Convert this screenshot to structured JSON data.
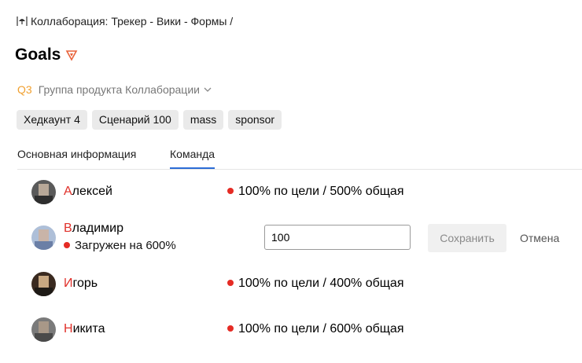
{
  "breadcrumb": {
    "icon": "umbrella-icon",
    "text": "Коллаборация: Трекер - Вики - Формы /"
  },
  "page": {
    "title": "Goals",
    "title_icon": "priority-triangle-icon",
    "title_icon_color": "#e8623a"
  },
  "meta": {
    "quarter": "Q3",
    "group": "Группа продукта Коллаборации",
    "quarter_color": "#f0a030"
  },
  "tags": [
    "Хедкаунт 4",
    "Сценарий 100",
    "mass",
    "sponsor"
  ],
  "tabs": [
    {
      "label": "Основная информация",
      "active": false
    },
    {
      "label": "Команда",
      "active": true
    }
  ],
  "members": [
    {
      "first": "А",
      "rest": "лексей",
      "stat": "100% по цели / 500% общая"
    },
    {
      "first": "В",
      "rest": "ладимир",
      "load": "Загружен на 600%",
      "input_value": "100"
    },
    {
      "first": "И",
      "rest": "горь",
      "stat": "100% по цели / 400% общая"
    },
    {
      "first": "Н",
      "rest": "икита",
      "stat": "100% по цели / 600% общая"
    }
  ],
  "editor": {
    "save_label": "Сохранить",
    "cancel_label": "Отмена"
  },
  "colors": {
    "accent": "#2b6cd6",
    "status_dot": "#e52b24",
    "name_initial": "#e0302a"
  }
}
